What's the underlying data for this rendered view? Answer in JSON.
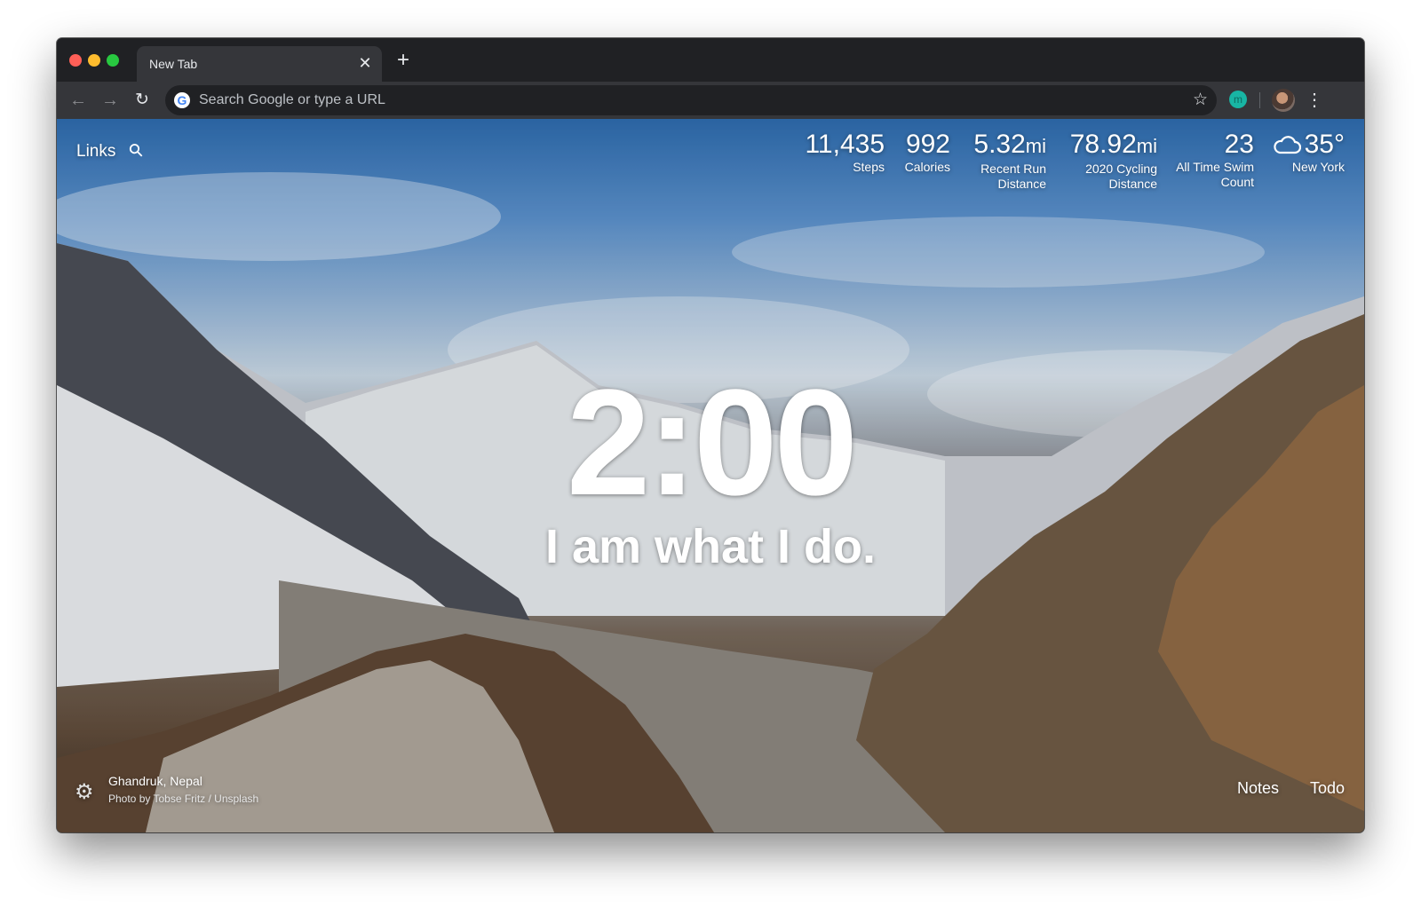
{
  "browser": {
    "tab_title": "New Tab",
    "tab_close": "✕",
    "new_tab": "+",
    "omnibox_placeholder": "Search Google or type a URL",
    "google_logo": "G",
    "extension_letter": "m",
    "icons": {
      "back": "arrow-left-icon",
      "forward": "arrow-right-icon",
      "reload": "reload-icon",
      "bookmark": "star-icon",
      "menu": "three-dots-icon"
    },
    "colors": {
      "close": "#fe5f57",
      "minimize": "#febc2e",
      "zoom": "#28c840",
      "extension": "#18b5a4"
    }
  },
  "momentum": {
    "links_label": "Links",
    "metrics": [
      {
        "value": "11,435",
        "unit": "",
        "label_line1": "Steps",
        "label_line2": ""
      },
      {
        "value": "992",
        "unit": "",
        "label_line1": "Calories",
        "label_line2": ""
      },
      {
        "value": "5.32",
        "unit": "mi",
        "label_line1": "Recent Run",
        "label_line2": "Distance"
      },
      {
        "value": "78.92",
        "unit": "mi",
        "label_line1": "2020 Cycling",
        "label_line2": "Distance"
      },
      {
        "value": "23",
        "unit": "",
        "label_line1": "All Time Swim",
        "label_line2": "Count"
      }
    ],
    "weather": {
      "temperature": "35°",
      "location": "New York",
      "icon": "cloud-icon"
    },
    "clock": "2:00",
    "mantra": "I am what I do.",
    "photo_location": "Ghandruk, Nepal",
    "photo_credit": "Photo by Tobse Fritz / Unsplash",
    "notes_label": "Notes",
    "todo_label": "Todo"
  }
}
